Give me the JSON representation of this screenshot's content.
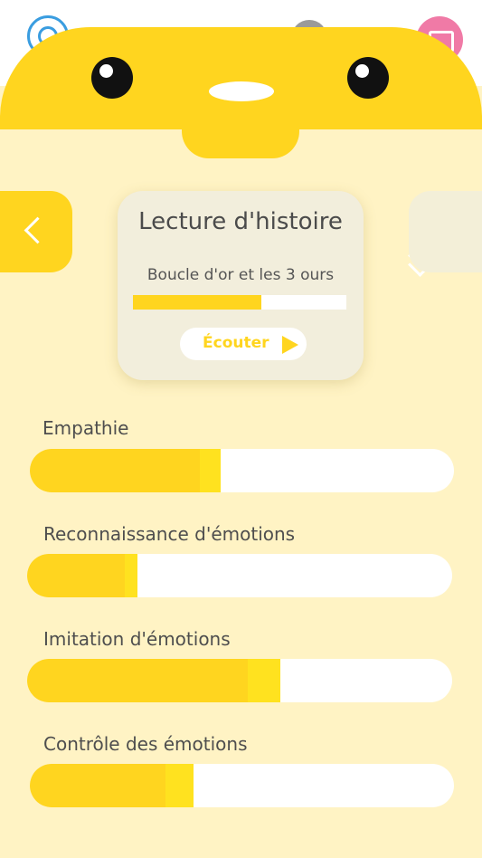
{
  "card": {
    "title": "Lecture d'histoire",
    "subtitle": "Boucle d'or et les 3 ours",
    "progress": 0.6,
    "listen_label": "Écouter"
  },
  "skills": [
    {
      "label": "Empathie",
      "base": 0.4,
      "tip": 0.05
    },
    {
      "label": "Reconnaissance d'émotions",
      "base": 0.23,
      "tip": 0.03
    },
    {
      "label": "Imitation d'émotions",
      "base": 0.52,
      "tip": 0.075
    },
    {
      "label": "Contrôle des émotions",
      "base": 0.32,
      "tip": 0.065
    }
  ],
  "icons": {
    "profile": "profile-icon",
    "menu": "gray-circle-icon",
    "book": "book-icon",
    "expand": "chevron-down-icon",
    "back": "chevron-left-icon",
    "play": "play-icon"
  },
  "colors": {
    "accent": "#ffd51f",
    "accent_tip": "#ffe21f",
    "background": "#fff3c4",
    "card": "#f2eedc"
  }
}
